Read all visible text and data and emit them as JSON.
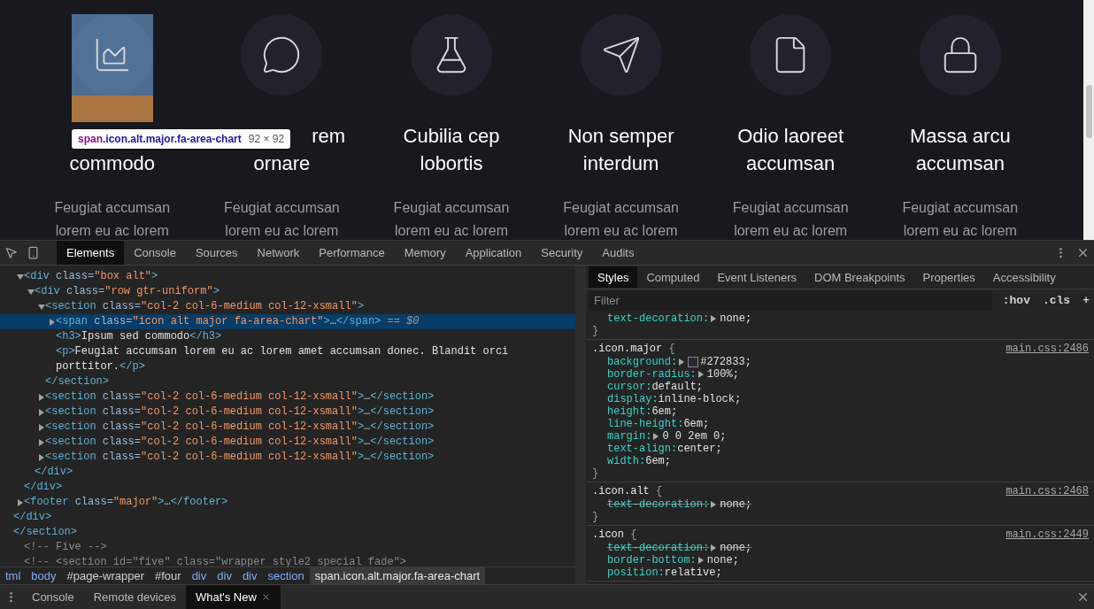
{
  "features": [
    {
      "kind": "area-chart",
      "highlighted": true,
      "title_lines": [
        {
          "text": "commodo"
        }
      ],
      "text_lines": [
        "Feugiat accumsan",
        "lorem eu ac lorem"
      ]
    },
    {
      "kind": "speech",
      "highlighted": false,
      "title_lines": [
        {
          "text": "rem",
          "covered": true
        },
        {
          "text": "ornare"
        }
      ],
      "text_lines": [
        "Feugiat accumsan",
        "lorem eu ac lorem"
      ]
    },
    {
      "kind": "flask",
      "highlighted": false,
      "title_lines": [
        {
          "text": "Cubilia cep"
        },
        {
          "text": "lobortis"
        }
      ],
      "text_lines": [
        "Feugiat accumsan",
        "lorem eu ac lorem"
      ]
    },
    {
      "kind": "plane",
      "highlighted": false,
      "title_lines": [
        {
          "text": "Non semper"
        },
        {
          "text": "interdum"
        }
      ],
      "text_lines": [
        "Feugiat accumsan",
        "lorem eu ac lorem"
      ]
    },
    {
      "kind": "file",
      "highlighted": false,
      "title_lines": [
        {
          "text": "Odio laoreet"
        },
        {
          "text": "accumsan"
        }
      ],
      "text_lines": [
        "Feugiat accumsan",
        "lorem eu ac lorem"
      ]
    },
    {
      "kind": "lock",
      "highlighted": false,
      "title_lines": [
        {
          "text": "Massa arcu"
        },
        {
          "text": "accumsan"
        }
      ],
      "text_lines": [
        "Feugiat accumsan",
        "lorem eu ac lorem"
      ]
    }
  ],
  "tooltip": {
    "tag": "span",
    "classes": ".icon.alt.major.fa-area-chart",
    "size": "92 × 92"
  },
  "devtools": {
    "tabs": [
      {
        "label": "Elements",
        "selected": true
      },
      {
        "label": "Console",
        "selected": false
      },
      {
        "label": "Sources",
        "selected": false
      },
      {
        "label": "Network",
        "selected": false
      },
      {
        "label": "Performance",
        "selected": false
      },
      {
        "label": "Memory",
        "selected": false
      },
      {
        "label": "Application",
        "selected": false
      },
      {
        "label": "Security",
        "selected": false
      },
      {
        "label": "Audits",
        "selected": false
      }
    ],
    "dom_tree": [
      {
        "children": [
          {
            "children": [
              {
                "line": "<div class=\"box alt\">",
                "expanded": true,
                "selected": false,
                "children": [
                  {
                    "line": "<div class=\"row gtr-uniform\">",
                    "expanded": true,
                    "selected": false,
                    "children": [
                      {
                        "line": "<section class=\"col-2 col-6-medium col-12-xsmall\">",
                        "expanded": true,
                        "selected": false,
                        "children": [
                          {
                            "line": "<span class=\"icon alt major fa-area-chart\">…</span>",
                            "suffix": "== $0",
                            "expanded": false,
                            "selected": true
                          },
                          {
                            "line": "<h3>Ipsum sed commodo</h3>",
                            "selected": false
                          },
                          {
                            "line": "<p>Feugiat accumsan lorem eu ac lorem amet accumsan donec. Blandit orci porttitor.</p>",
                            "selected": false
                          }
                        ],
                        "close": "</section>"
                      },
                      {
                        "line": "<section class=\"col-2 col-6-medium col-12-xsmall\">…</section>",
                        "expanded": false,
                        "selected": false
                      },
                      {
                        "line": "<section class=\"col-2 col-6-medium col-12-xsmall\">…</section>",
                        "expanded": false,
                        "selected": false
                      },
                      {
                        "line": "<section class=\"col-2 col-6-medium col-12-xsmall\">…</section>",
                        "expanded": false,
                        "selected": false
                      },
                      {
                        "line": "<section class=\"col-2 col-6-medium col-12-xsmall\">…</section>",
                        "expanded": false,
                        "selected": false
                      },
                      {
                        "line": "<section class=\"col-2 col-6-medium col-12-xsmall\">…</section>",
                        "expanded": false,
                        "selected": false
                      }
                    ],
                    "close": "</div>"
                  }
                ],
                "close": "</div>"
              },
              {
                "line": "<footer class=\"major\">…</footer>",
                "expanded": false,
                "selected": false
              }
            ],
            "close": "</div>"
          }
        ],
        "close": "</section>"
      },
      {
        "line": "<!-- Five -->",
        "selected": false
      },
      {
        "line": "<!-- <section id=\"five\" class=\"wrapper style2 special fade\">",
        "selected": false
      }
    ],
    "breadcrumbs": [
      {
        "label": "tml",
        "kind": "tag",
        "selected": false
      },
      {
        "label": "body",
        "kind": "tag",
        "selected": false
      },
      {
        "label": "#page-wrapper",
        "kind": "id",
        "selected": false
      },
      {
        "label": "#four",
        "kind": "id",
        "selected": false
      },
      {
        "label": "div",
        "kind": "tag",
        "selected": false
      },
      {
        "label": "div",
        "kind": "tag",
        "selected": false
      },
      {
        "label": "div",
        "kind": "tag",
        "selected": false
      },
      {
        "label": "section",
        "kind": "tag",
        "selected": false
      },
      {
        "label": "span.icon.alt.major.fa-area-chart",
        "kind": "tag",
        "selected": true
      }
    ],
    "side_tabs": [
      {
        "label": "Styles",
        "selected": true
      },
      {
        "label": "Computed",
        "selected": false
      },
      {
        "label": "Event Listeners",
        "selected": false
      },
      {
        "label": "DOM Breakpoints",
        "selected": false
      },
      {
        "label": "Properties",
        "selected": false
      },
      {
        "label": "Accessibility",
        "selected": false
      }
    ],
    "filter": {
      "placeholder": "Filter"
    },
    "filter_buttons": [
      ":hov",
      ".cls",
      "+"
    ],
    "rules": [
      {
        "props": [
          {
            "name": "text-decoration:",
            "value": "none;",
            "expandable": true,
            "overridden": false
          }
        ],
        "close": "}"
      },
      {
        "selector": ".icon.major",
        "open": "{",
        "source": "main.css:2486",
        "props": [
          {
            "name": "background:",
            "value": "#272833;",
            "expandable": true,
            "overridden": false,
            "color": "#272833"
          },
          {
            "name": "border-radius:",
            "value": "100%;",
            "expandable": true,
            "overridden": false
          },
          {
            "name": "cursor:",
            "value": "default;",
            "expandable": false,
            "overridden": false
          },
          {
            "name": "display:",
            "value": "inline-block;",
            "expandable": false,
            "overridden": false
          },
          {
            "name": "height:",
            "value": "6em;",
            "expandable": false,
            "overridden": false
          },
          {
            "name": "line-height:",
            "value": "6em;",
            "expandable": false,
            "overridden": false
          },
          {
            "name": "margin:",
            "value": "0 0 2em 0;",
            "expandable": true,
            "overridden": false
          },
          {
            "name": "text-align:",
            "value": "center;",
            "expandable": false,
            "overridden": false
          },
          {
            "name": "width:",
            "value": "6em;",
            "expandable": false,
            "overridden": false
          }
        ],
        "close": "}"
      },
      {
        "selector": ".icon.alt",
        "open": "{",
        "source": "main.css:2468",
        "props": [
          {
            "name": "text-decoration:",
            "value": "none;",
            "expandable": true,
            "overridden": true
          }
        ],
        "close": "}"
      },
      {
        "selector": ".icon",
        "open": "{",
        "source": "main.css:2449",
        "props": [
          {
            "name": "text-decoration:",
            "value": "none;",
            "expandable": true,
            "overridden": true
          },
          {
            "name": "border-bottom:",
            "value": "none;",
            "expandable": true,
            "overridden": false
          },
          {
            "name": "position:",
            "value": "relative;",
            "expandable": false,
            "overridden": false
          }
        ]
      }
    ],
    "drawer_tabs": [
      {
        "label": "Console",
        "selected": false,
        "closable": false
      },
      {
        "label": "Remote devices",
        "selected": false,
        "closable": false
      },
      {
        "label": "What's New",
        "selected": true,
        "closable": true
      }
    ]
  }
}
